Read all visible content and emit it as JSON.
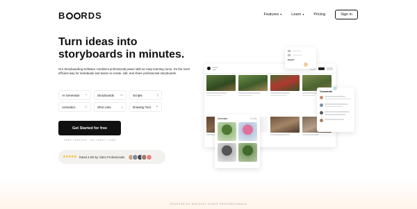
{
  "brand": {
    "logo_text": "BOORDS"
  },
  "nav": {
    "features": "Features",
    "learn": "Learn",
    "pricing": "Pricing",
    "signin": "Sign in"
  },
  "hero": {
    "headline_line1": "Turn ideas into",
    "headline_line2": "storyboards in minutes.",
    "subtext": "Our Storyboarding Software combines professional power with an easy learning curve. It's the most efficient way for individuals and teams to create, edit, and share professional storyboards."
  },
  "chips": [
    {
      "prefix": "AI",
      "label": "Generator",
      "icon": "sparkle-icon"
    },
    {
      "label": "Storyboards",
      "icon": "storyboard-icon"
    },
    {
      "label": "Scripts",
      "icon": "script-icon"
    },
    {
      "label": "Animatics",
      "icon": "play-icon"
    },
    {
      "label": "Shot Lists",
      "icon": "list-icon"
    },
    {
      "label": "Drawing Tool",
      "icon": "pencil-icon"
    }
  ],
  "cta": {
    "label": "Get Started for free",
    "note": "FREE FOREVER · NO CREDIT CARD"
  },
  "rating": {
    "stars": "★★★★★",
    "text": "Rated 4.9/5 by Video Professionals"
  },
  "mockup": {
    "generator_title": "Generator",
    "generator_tag": "Shuffle",
    "comments_title": "Comments",
    "export_label": "Export"
  },
  "footer": {
    "trusted": "TRUSTED BY 800,000+ VIDEO PROFESSIONALS"
  },
  "colors": {
    "accent": "#111111",
    "star": "#f0b400",
    "page_bg": "#ffffff",
    "warm_fade": "#fff4ea"
  }
}
